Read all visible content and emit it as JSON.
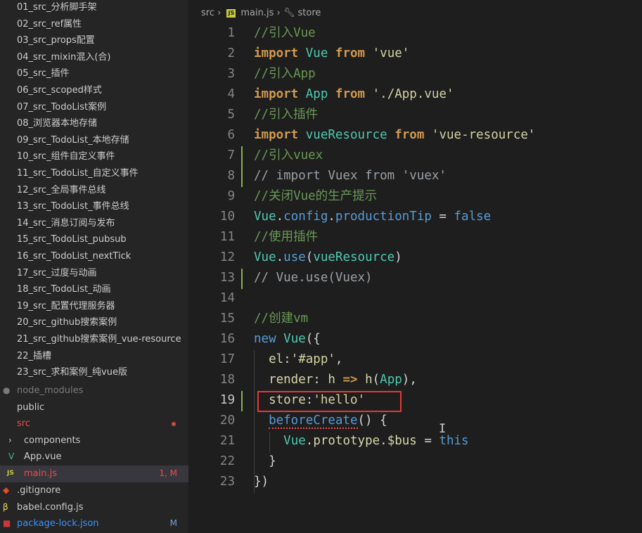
{
  "sidebar": {
    "folders": [
      "01_src_分析脚手架",
      "02_src_ref属性",
      "03_src_props配置",
      "04_src_mixin混入(合)",
      "05_src_插件",
      "06_src_scoped样式",
      "07_src_TodoList案例",
      "08_浏览器本地存储",
      "09_src_TodoList_本地存储",
      "10_src_组件自定义事件",
      "11_src_TodoList_自定义事件",
      "12_src_全局事件总线",
      "13_src_TodoList_事件总线",
      "14_src_消息订阅与发布",
      "15_src_TodoList_pubsub",
      "16_src_TodoList_nextTick",
      "17_src_过度与动画",
      "18_src_TodoList_动画",
      "19_src_配置代理服务器",
      "20_src_github搜索案例",
      "21_src_github搜索案例_vue-resource",
      "22_插槽",
      "23_src_求和案例_纯vue版"
    ],
    "node_modules": "node_modules",
    "public": "public",
    "src": "src",
    "components": "components",
    "app_vue": "App.vue",
    "main_js": "main.js",
    "main_js_status": "1, M",
    "gitignore": ".gitignore",
    "babel_config": "babel.config.js",
    "package_lock": "package-lock.json",
    "package_lock_status": "M",
    "colors": {
      "modified": "#f14c4c",
      "untracked": "#3794ff",
      "ignored": "#7a7a7a"
    }
  },
  "breadcrumb": {
    "folder": "src",
    "file": "main.js",
    "symbol": "store",
    "js_badge": "JS"
  },
  "editor": {
    "active_line": 19,
    "lines": [
      {
        "n": "1",
        "tokens": [
          {
            "t": "//引入Vue",
            "c": "cm"
          }
        ]
      },
      {
        "n": "2",
        "tokens": [
          {
            "t": "import",
            "c": "kw"
          },
          {
            "t": " ",
            "c": "plain"
          },
          {
            "t": "Vue",
            "c": "cls"
          },
          {
            "t": " ",
            "c": "plain"
          },
          {
            "t": "from",
            "c": "kw"
          },
          {
            "t": " ",
            "c": "plain"
          },
          {
            "t": "'vue'",
            "c": "str"
          }
        ]
      },
      {
        "n": "3",
        "tokens": [
          {
            "t": "//引入App",
            "c": "cm"
          }
        ]
      },
      {
        "n": "4",
        "tokens": [
          {
            "t": "import",
            "c": "kw"
          },
          {
            "t": " ",
            "c": "plain"
          },
          {
            "t": "App",
            "c": "cls"
          },
          {
            "t": " ",
            "c": "plain"
          },
          {
            "t": "from",
            "c": "kw"
          },
          {
            "t": " ",
            "c": "plain"
          },
          {
            "t": "'./App.vue'",
            "c": "str"
          }
        ]
      },
      {
        "n": "5",
        "tokens": [
          {
            "t": "//引入插件",
            "c": "cm"
          }
        ]
      },
      {
        "n": "6",
        "tokens": [
          {
            "t": "import",
            "c": "kw"
          },
          {
            "t": " ",
            "c": "plain"
          },
          {
            "t": "vueResource",
            "c": "cls"
          },
          {
            "t": " ",
            "c": "plain"
          },
          {
            "t": "from",
            "c": "kw"
          },
          {
            "t": " ",
            "c": "plain"
          },
          {
            "t": "'vue-resource'",
            "c": "str"
          }
        ]
      },
      {
        "n": "7",
        "tokens": [
          {
            "t": "//引入vuex",
            "c": "cm"
          }
        ]
      },
      {
        "n": "8",
        "tokens": [
          {
            "t": "// import Vuex from 'vuex'",
            "c": "cmt"
          }
        ]
      },
      {
        "n": "9",
        "tokens": [
          {
            "t": "//关闭Vue的生产提示",
            "c": "cm"
          }
        ]
      },
      {
        "n": "10",
        "tokens": [
          {
            "t": "Vue",
            "c": "cls"
          },
          {
            "t": ".",
            "c": "plain"
          },
          {
            "t": "config",
            "c": "fn"
          },
          {
            "t": ".",
            "c": "plain"
          },
          {
            "t": "productionTip",
            "c": "fn"
          },
          {
            "t": " = ",
            "c": "plain"
          },
          {
            "t": "false",
            "c": "fn"
          }
        ]
      },
      {
        "n": "11",
        "tokens": [
          {
            "t": "//使用插件",
            "c": "cm"
          }
        ]
      },
      {
        "n": "12",
        "tokens": [
          {
            "t": "Vue",
            "c": "cls"
          },
          {
            "t": ".",
            "c": "plain"
          },
          {
            "t": "use",
            "c": "fn"
          },
          {
            "t": "(",
            "c": "plain"
          },
          {
            "t": "vueResource",
            "c": "cls"
          },
          {
            "t": ")",
            "c": "plain"
          }
        ]
      },
      {
        "n": "13",
        "tokens": [
          {
            "t": "// Vue.use(Vuex)",
            "c": "cmt"
          }
        ]
      },
      {
        "n": "14",
        "tokens": []
      },
      {
        "n": "15",
        "tokens": [
          {
            "t": "//创建vm",
            "c": "cm"
          }
        ]
      },
      {
        "n": "16",
        "tokens": [
          {
            "t": "new",
            "c": "fn"
          },
          {
            "t": " ",
            "c": "plain"
          },
          {
            "t": "Vue",
            "c": "cls"
          },
          {
            "t": "({",
            "c": "plain"
          }
        ]
      },
      {
        "n": "17",
        "tokens": [
          {
            "t": "  ",
            "c": "plain"
          },
          {
            "t": "el",
            "c": "key"
          },
          {
            "t": ":",
            "c": "plain"
          },
          {
            "t": "'#app'",
            "c": "str"
          },
          {
            "t": ",",
            "c": "plain"
          }
        ]
      },
      {
        "n": "18",
        "tokens": [
          {
            "t": "  ",
            "c": "plain"
          },
          {
            "t": "render",
            "c": "key"
          },
          {
            "t": ": ",
            "c": "plain"
          },
          {
            "t": "h",
            "c": "key"
          },
          {
            "t": " => ",
            "c": "kw"
          },
          {
            "t": "h",
            "c": "key"
          },
          {
            "t": "(",
            "c": "plain"
          },
          {
            "t": "App",
            "c": "cls"
          },
          {
            "t": "),",
            "c": "plain"
          }
        ]
      },
      {
        "n": "19",
        "tokens": [
          {
            "t": "  ",
            "c": "plain"
          },
          {
            "t": "store",
            "c": "key"
          },
          {
            "t": ":",
            "c": "plain"
          },
          {
            "t": "'hello'",
            "c": "str"
          }
        ]
      },
      {
        "n": "20",
        "tokens": [
          {
            "t": "  ",
            "c": "plain"
          },
          {
            "t": "beforeCreate",
            "c": "fn squiggle"
          },
          {
            "t": "() {",
            "c": "plain"
          }
        ]
      },
      {
        "n": "21",
        "tokens": [
          {
            "t": "    ",
            "c": "plain"
          },
          {
            "t": "Vue",
            "c": "cls"
          },
          {
            "t": ".",
            "c": "plain"
          },
          {
            "t": "prototype",
            "c": "key"
          },
          {
            "t": ".",
            "c": "plain"
          },
          {
            "t": "$bus",
            "c": "key"
          },
          {
            "t": " = ",
            "c": "plain"
          },
          {
            "t": "this",
            "c": "fn"
          }
        ]
      },
      {
        "n": "22",
        "tokens": [
          {
            "t": "  }",
            "c": "plain"
          }
        ]
      },
      {
        "n": "23",
        "tokens": [
          {
            "t": "})",
            "c": "plain"
          }
        ]
      }
    ]
  }
}
